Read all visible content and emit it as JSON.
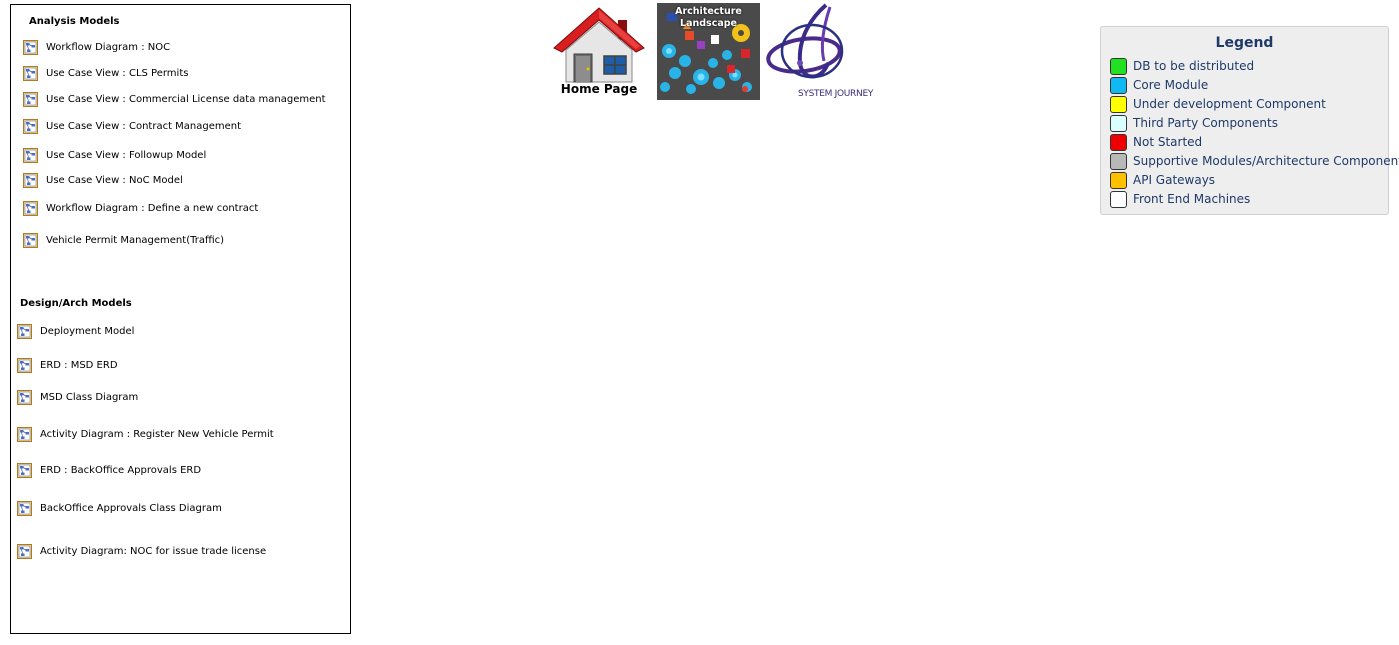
{
  "models_panel": {
    "analysis_title": "Analysis Models",
    "analysis_items": [
      {
        "label": "Workflow Diagram : NOC",
        "icon": "diagram-icon"
      },
      {
        "label": "Use Case View : CLS Permits",
        "icon": "diagram-icon"
      },
      {
        "label": "Use Case View : Commercial License data management",
        "icon": "diagram-icon"
      },
      {
        "label": "Use Case View : Contract Management",
        "icon": "diagram-icon"
      },
      {
        "label": "Use Case View : Followup Model",
        "icon": "diagram-icon"
      },
      {
        "label": "Use Case View : NoC Model",
        "icon": "diagram-icon"
      },
      {
        "label": "Workflow Diagram : Define a new contract",
        "icon": "diagram-icon"
      },
      {
        "label": "Vehicle Permit Management(Traffic)",
        "icon": "diagram-icon"
      }
    ],
    "design_title": "Design/Arch Models",
    "design_items": [
      {
        "label": "Deployment Model",
        "icon": "diagram-icon"
      },
      {
        "label": "ERD : MSD ERD",
        "icon": "diagram-icon"
      },
      {
        "label": "MSD Class Diagram",
        "icon": "diagram-icon"
      },
      {
        "label": "Activity Diagram : Register New Vehicle Permit",
        "icon": "diagram-icon"
      },
      {
        "label": "ERD : BackOffice Approvals ERD",
        "icon": "diagram-icon"
      },
      {
        "label": "BackOffice Approvals Class Diagram",
        "icon": "diagram-icon"
      },
      {
        "label": "Activity Diagram: NOC for issue trade license",
        "icon": "diagram-icon"
      }
    ]
  },
  "nav": {
    "home_label": "Home Page",
    "architecture_title_line1": "Architecture",
    "architecture_title_line2": "Landscape",
    "journey_label": "SYSTEM JOURNEY"
  },
  "legend": {
    "title": "Legend",
    "items": [
      {
        "label": "DB to be distributed",
        "color": "#22e022"
      },
      {
        "label": "Core Module",
        "color": "#12b8f2"
      },
      {
        "label": "Under development Component",
        "color": "#ffff00"
      },
      {
        "label": "Third Party Components",
        "color": "#d9ffff"
      },
      {
        "label": "Not Started",
        "color": "#ee0000"
      },
      {
        "label": "Supportive Modules/Architecture Component",
        "color": "#b8b8b8"
      },
      {
        "label": "API Gateways",
        "color": "#ffc000"
      },
      {
        "label": "Front End Machines",
        "color": "#ffffff"
      }
    ]
  }
}
